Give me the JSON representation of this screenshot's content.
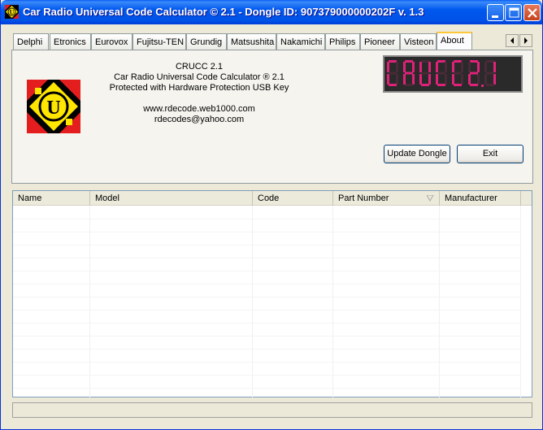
{
  "window": {
    "title": "Car Radio Universal Code Calculator © 2.1 - Dongle ID: 907379000000202F v. 1.3",
    "minimize_icon": "minimize-icon",
    "maximize_icon": "maximize-icon",
    "close_icon": "close-icon"
  },
  "tabs": [
    {
      "label": "Delphi"
    },
    {
      "label": "Etronics"
    },
    {
      "label": "Eurovox"
    },
    {
      "label": "Fujitsu-TEN"
    },
    {
      "label": "Grundig"
    },
    {
      "label": "Matsushita"
    },
    {
      "label": "Nakamichi"
    },
    {
      "label": "Philips"
    },
    {
      "label": "Pioneer"
    },
    {
      "label": "Visteon"
    },
    {
      "label": "About"
    }
  ],
  "active_tab": "About",
  "about": {
    "app_name": "CRUCC 2.1",
    "full_name": "Car Radio Universal Code Calculator ® 2.1",
    "protection": "Protected with Hardware Protection USB Key",
    "website": "www.rdecode.web1000.com",
    "email": "rdecodes@yahoo.com",
    "lcd_text": "CRUCC 2.1",
    "logo_letter": "U"
  },
  "buttons": {
    "update_dongle": "Update Dongle",
    "exit": "Exit"
  },
  "table": {
    "columns": [
      "Name",
      "Model",
      "Code",
      "Part Number",
      "Manufacturer"
    ],
    "sorted_column": "Part Number",
    "rows": []
  },
  "colors": {
    "lcd_segment": "#e0217a",
    "logo_red": "#e41e1e",
    "logo_yellow": "#ffe600",
    "logo_black": "#000000"
  }
}
